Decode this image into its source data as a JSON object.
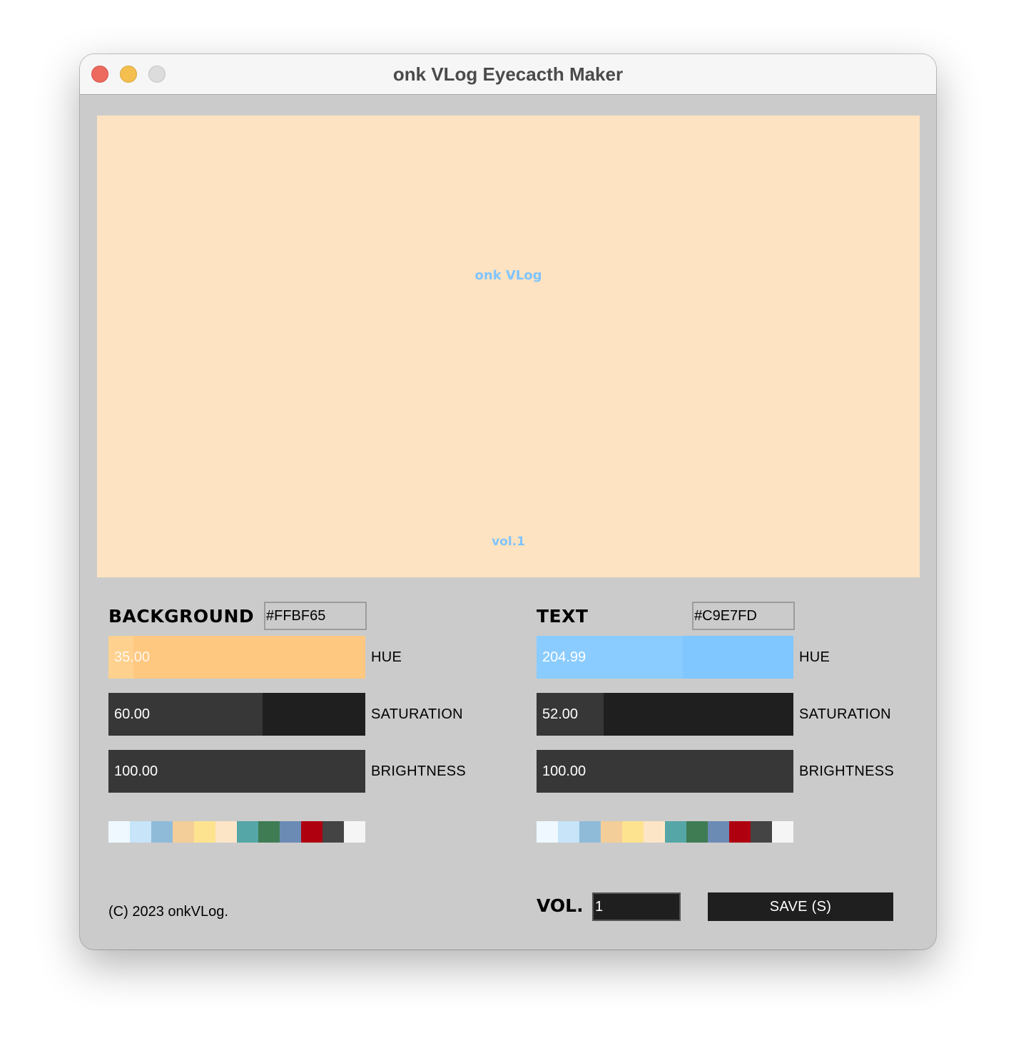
{
  "window": {
    "title": "onk VLog Eyecacth Maker"
  },
  "preview": {
    "background_color": "#FDE3C1",
    "text_color": "#7FC4FD",
    "title_text": "onk VLog",
    "volume_text": "vol.1"
  },
  "background": {
    "label": "BACKGROUND",
    "hex": "#FFBF65",
    "hue": {
      "label": "HUE",
      "value": "35.00",
      "fraction": 0.097,
      "fill_color": "#FFC880",
      "track_color": "#FFC880",
      "head_color": "#FFD18F"
    },
    "saturation": {
      "label": "SATURATION",
      "value": "60.00",
      "fraction": 0.6,
      "fill_color": "#373737",
      "track_color": "#1F1F1F"
    },
    "brightness": {
      "label": "BRIGHTNESS",
      "value": "100.00",
      "fraction": 1.0,
      "fill_color": "#373737",
      "track_color": "#1F1F1F"
    }
  },
  "text": {
    "label": "TEXT",
    "hex": "#C9E7FD",
    "hue": {
      "label": "HUE",
      "value": "204.99",
      "fraction": 0.569,
      "fill_color": "#8ACCFF",
      "track_color": "#80C6FF"
    },
    "saturation": {
      "label": "SATURATION",
      "value": "52.00",
      "fraction": 0.26,
      "fill_color": "#373737",
      "track_color": "#1F1F1F"
    },
    "brightness": {
      "label": "BRIGHTNESS",
      "value": "100.00",
      "fraction": 1.0,
      "fill_color": "#373737",
      "track_color": "#1F1F1F"
    }
  },
  "palette": [
    "#EEF8FE",
    "#C7E4F8",
    "#8FBBD9",
    "#F4CE98",
    "#FDE38F",
    "#FCE5C7",
    "#55A6A6",
    "#3F7C54",
    "#6B8BB5",
    "#AF0010",
    "#444444",
    "#F5F5F5"
  ],
  "footer": {
    "copyright": "(C) 2023 onkVLog.",
    "vol_label": "VOL.",
    "vol_value": "1",
    "save_label": "SAVE (S)"
  }
}
